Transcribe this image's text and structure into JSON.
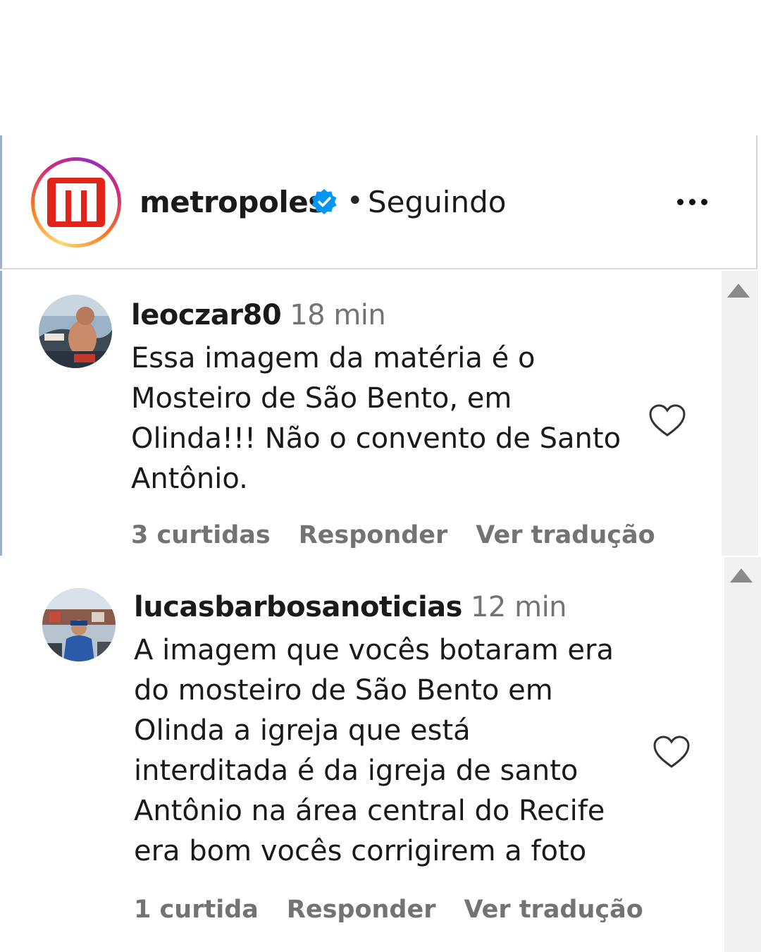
{
  "header": {
    "username": "metropoles",
    "separator": "•",
    "follow_status": "Seguindo",
    "verified_icon": "verified-badge-icon",
    "more_icon": "more-options-icon"
  },
  "comments": [
    {
      "username": "leoczar80",
      "time": "18 min",
      "text": "Essa imagem da matéria é o Mosteiro de São Bento, em Olinda!!! Não o convento de Santo Antônio.",
      "likes": "3 curtidas",
      "reply": "Responder",
      "translate": "Ver tradução"
    },
    {
      "username": "lucasbarbosanoticias",
      "time": "12 min",
      "text": "A imagem que vocês botaram era do mosteiro de São Bento em Olinda a igreja que está interditada é da igreja de santo Antônio na área central do Recife era bom vocês corrigirem a foto",
      "likes": "1 curtida",
      "reply": "Responder",
      "translate": "Ver tradução"
    }
  ],
  "colors": {
    "brand_red": "#e2231a",
    "verified_blue": "#0095f6",
    "muted_text": "#737373"
  }
}
